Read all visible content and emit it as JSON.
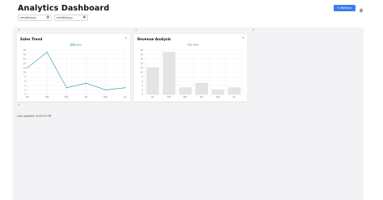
{
  "header": {
    "title": "Analytics Dashboard",
    "refresh_label": "Refresh",
    "refresh_icon": "↻",
    "settings_icon": "gear-icon"
  },
  "filters": {
    "start_date": "mm/dd/yyyy",
    "end_date": "mm/dd/yyyy",
    "calendar_icon": "calendar-icon"
  },
  "grid": {
    "handle_glyph": "⇕"
  },
  "cards": {
    "sales": {
      "title": "Sales Trend",
      "close": "×"
    },
    "revenue": {
      "title": "Revenue Analysis",
      "close": "×"
    }
  },
  "footer": {
    "last_updated": "Last updated: 6:35:03 PM"
  },
  "colors": {
    "accent": "#3b7ded",
    "sales_line": "#3aa6b9",
    "revenue_bar": "#e4e4e4",
    "revenue_bar_border": "#c8c8c8"
  },
  "chart_data": [
    {
      "type": "line",
      "title": "",
      "categories": [
        "Jan",
        "Feb",
        "Mar",
        "Apr",
        "May",
        "Jun"
      ],
      "series": [
        {
          "name": "Sales",
          "values": [
            12,
            19,
            3,
            5,
            2,
            3
          ]
        }
      ],
      "ylim": [
        0,
        20
      ],
      "yticks": [
        0,
        2,
        4,
        6,
        8,
        10,
        12,
        14,
        16,
        18,
        20
      ],
      "grid": true,
      "legend": "top-center"
    },
    {
      "type": "bar",
      "title": "",
      "categories": [
        "Jan",
        "Feb",
        "Mar",
        "Apr",
        "May",
        "Jun"
      ],
      "series": [
        {
          "name": "Sales",
          "values": [
            12,
            19,
            3,
            5,
            2,
            3
          ]
        }
      ],
      "ylim": [
        0,
        20
      ],
      "yticks": [
        0,
        2,
        4,
        6,
        8,
        10,
        12,
        14,
        16,
        18,
        20
      ],
      "grid": true,
      "legend": "top-center"
    }
  ]
}
